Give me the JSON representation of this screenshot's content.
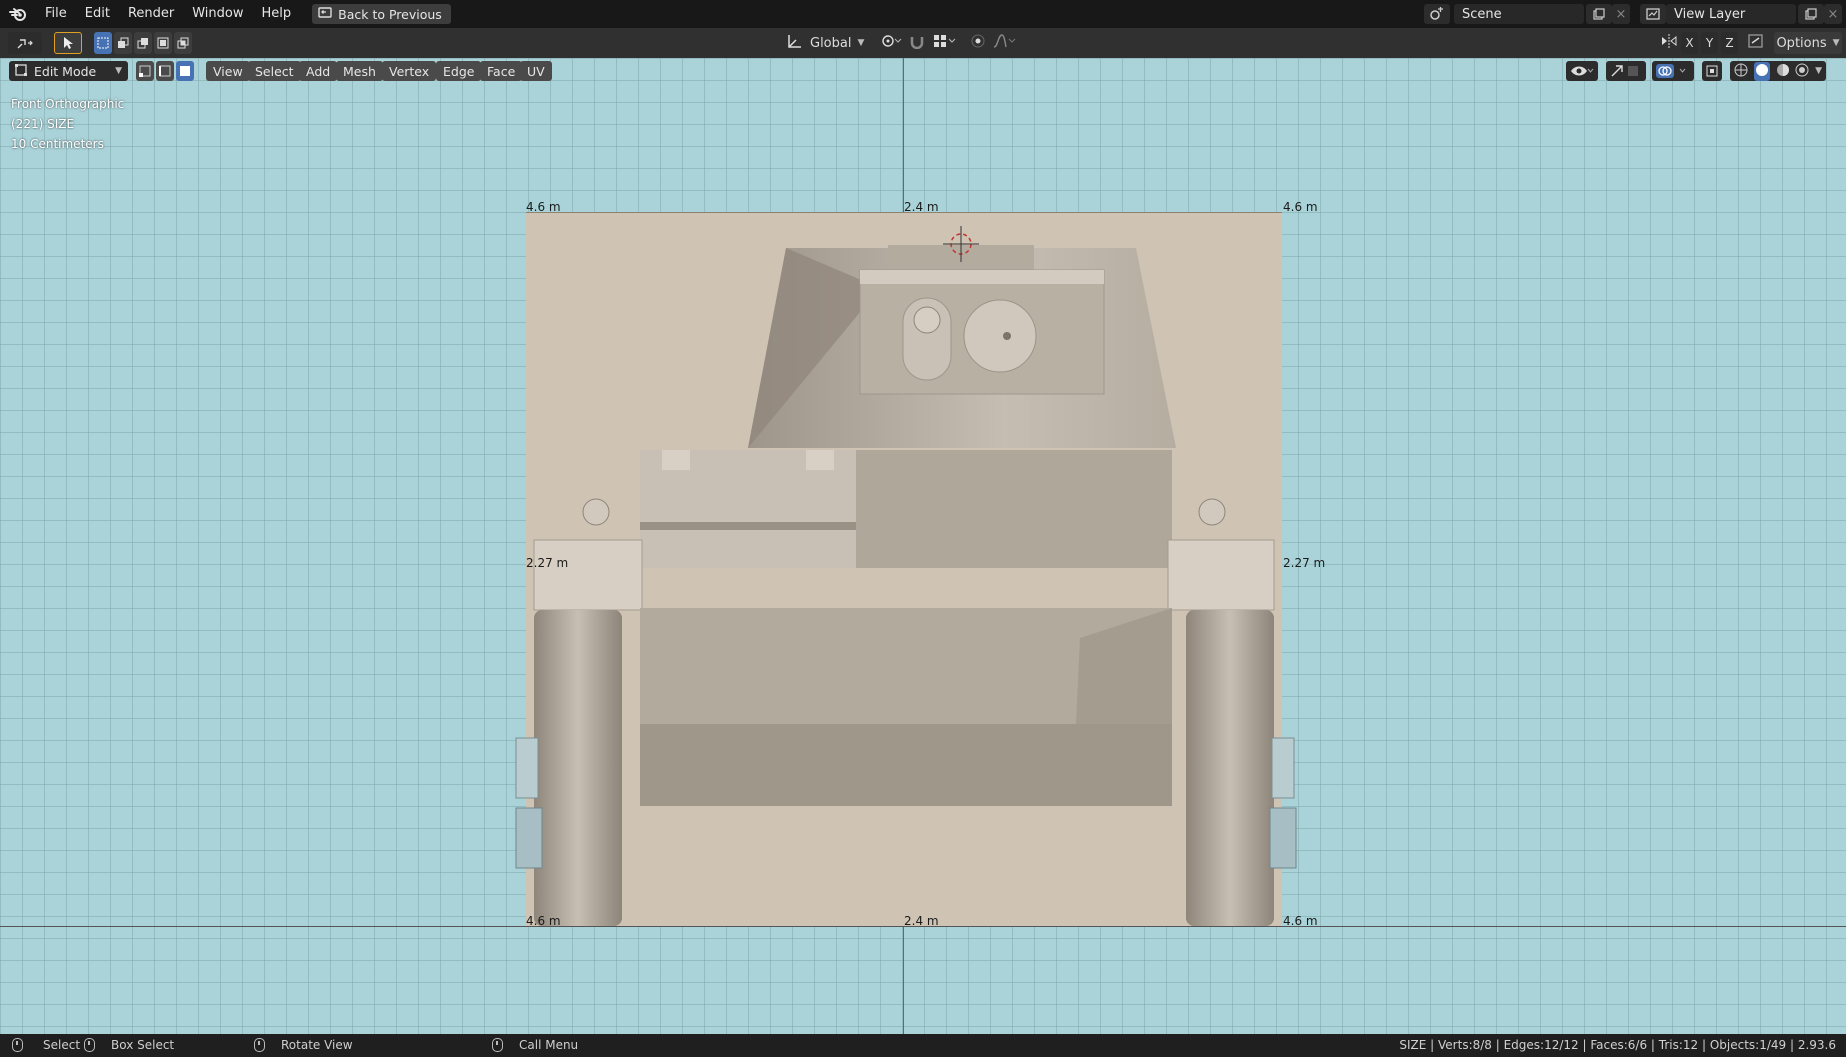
{
  "menubar": {
    "items": [
      "File",
      "Edit",
      "Render",
      "Window",
      "Help"
    ],
    "back_button": "Back to Previous",
    "scene_name": "Scene",
    "view_layer": "View Layer"
  },
  "toolbar": {
    "transform_orientation": "Global",
    "axis_labels": [
      "X",
      "Y",
      "Z"
    ],
    "options_label": "Options"
  },
  "viewport": {
    "mode": "Edit Mode",
    "header_menus": [
      "View",
      "Select",
      "Add",
      "Mesh",
      "Vertex",
      "Edge",
      "Face",
      "UV"
    ],
    "info_lines": [
      "Front Orthographic",
      "(221) SIZE",
      "10 Centimeters"
    ],
    "rulers": {
      "top_left": "4.6 m",
      "top_center": "2.4 m",
      "top_right": "4.6 m",
      "mid_left": "2.27 m",
      "mid_right": "2.27 m",
      "bottom_left": "4.6 m",
      "bottom_center": "2.4 m",
      "bottom_right": "4.6 m"
    }
  },
  "statusbar": {
    "select": "Select",
    "box_select": "Box Select",
    "rotate_view": "Rotate View",
    "call_menu": "Call Menu",
    "stats": "SIZE | Verts:8/8 | Edges:12/12 | Faces:6/6 | Tris:12 | Objects:1/49 | 2.93.6"
  },
  "colors": {
    "viewport_bg": "#a9d3d9",
    "active_blue": "#4772b3",
    "axis_blue": "#3a6fb4",
    "model_surface": "#cfc4b3"
  }
}
